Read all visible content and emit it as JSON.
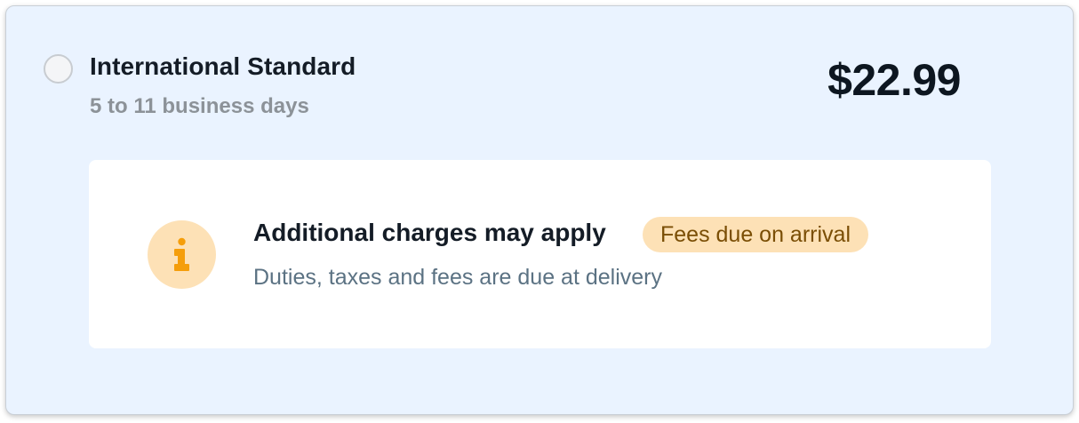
{
  "shipping_option": {
    "title": "International Standard",
    "delivery_time": "5 to 11 business days",
    "price": "$22.99",
    "selected": false
  },
  "notice": {
    "icon": "info-icon",
    "title": "Additional charges may apply",
    "badge": "Fees due on arrival",
    "description": "Duties, taxes and fees are due at delivery"
  },
  "colors": {
    "card_background": "#eaf3ff",
    "notice_background": "#ffffff",
    "accent": "#f59e0b",
    "badge_background": "#fde1b6",
    "badge_text": "#7a4e05"
  }
}
